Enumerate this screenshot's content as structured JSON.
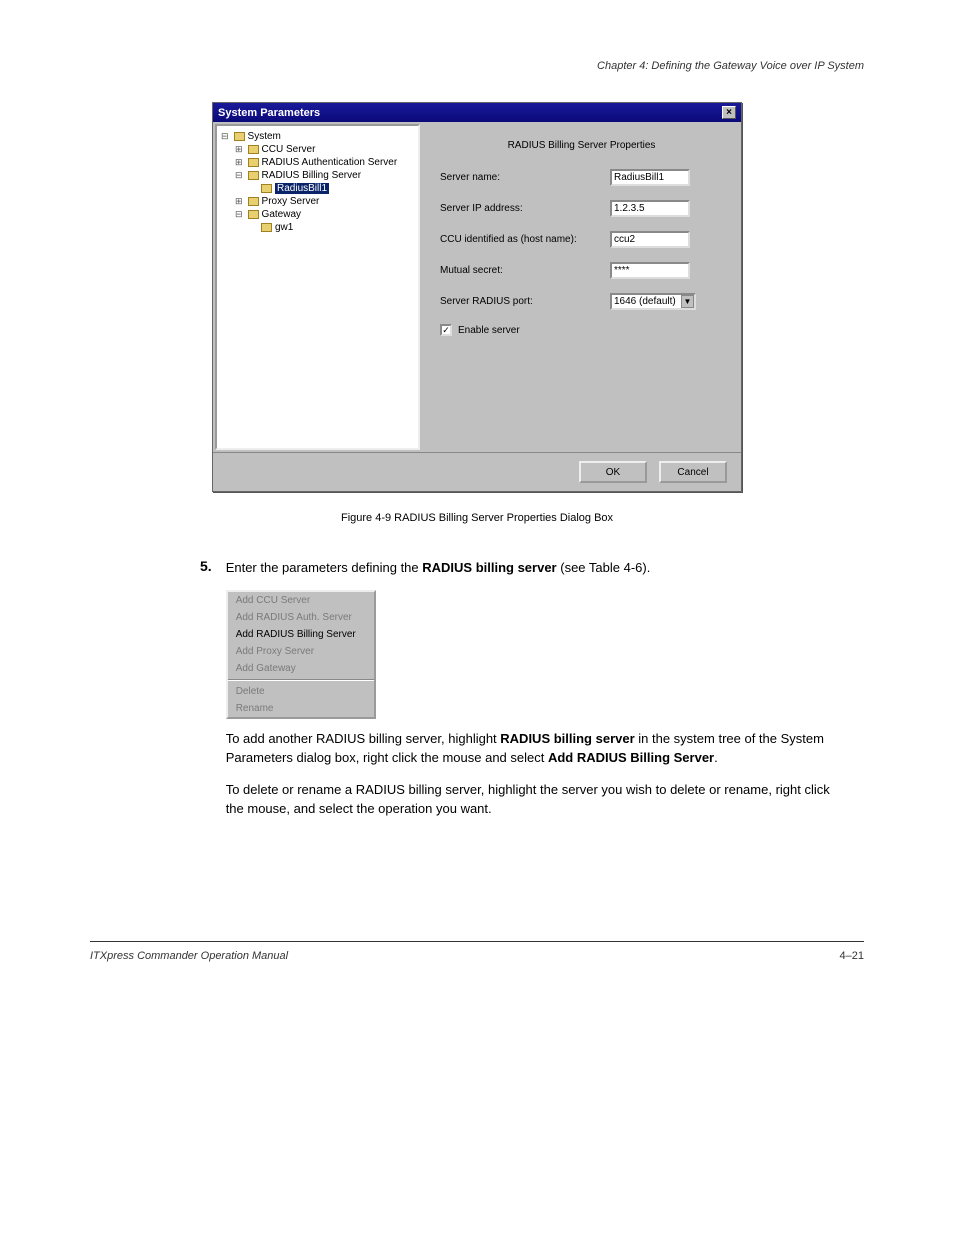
{
  "chapterTitle": "Chapter 4: Defining the Gateway Voice over IP System",
  "dialog": {
    "title": "System Parameters",
    "tree": {
      "root": "System",
      "n1": "CCU Server",
      "n2": "RADIUS Authentication Server",
      "n3": "RADIUS Billing Server",
      "n3a": "RadiusBill1",
      "n4": "Proxy Server",
      "n5": "Gateway",
      "n5a": "gw1"
    },
    "propsTitle": "RADIUS Billing Server Properties",
    "rows": {
      "serverNameLabel": "Server name:",
      "serverNameVal": "RadiusBill1",
      "ipLabel": "Server IP address:",
      "ipVal": "1.2.3.5",
      "ccuLabel": "CCU identified as (host name):",
      "ccuVal": "ccu2",
      "secretLabel": "Mutual secret:",
      "secretVal": "****",
      "portLabel": "Server RADIUS port:",
      "portVal": "1646 (default)",
      "enableLabel": "Enable server"
    },
    "ok": "OK",
    "cancel": "Cancel"
  },
  "figureCaption": "Figure 4-9 RADIUS Billing Server Properties Dialog Box",
  "step": {
    "num": "5.",
    "line1a": "Enter the parameters defining the ",
    "line1b": "RADIUS billing server",
    "line1c": " (see Table 4-6).",
    "line2a": "To add another RADIUS billing server, highlight ",
    "line2b": "RADIUS billing server",
    "line2c": " in the system tree of the System Parameters dialog box, right click the mouse and select ",
    "line2d": "Add RADIUS Billing Server",
    "line2e": ".",
    "line3": "To delete or rename a RADIUS billing server, highlight the server you wish to delete or rename, right click the mouse, and select the operation you want."
  },
  "menu": {
    "m1": "Add CCU Server",
    "m2": "Add RADIUS Auth. Server",
    "m3": "Add RADIUS Billing Server",
    "m4": "Add Proxy Server",
    "m5": "Add Gateway",
    "m6": "Delete",
    "m7": "Rename"
  },
  "footer": {
    "left": "ITXpress Commander Operation Manual",
    "right": "4–21"
  }
}
